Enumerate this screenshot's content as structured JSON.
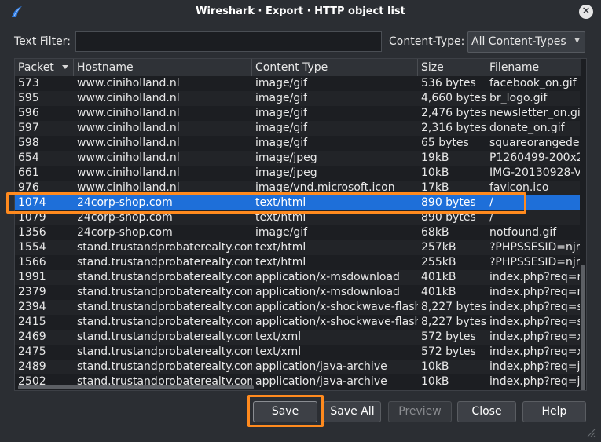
{
  "window": {
    "title": "Wireshark · Export · HTTP object list"
  },
  "filter": {
    "label": "Text Filter:",
    "value": ""
  },
  "content_type": {
    "label": "Content-Type:",
    "selected": "All Content-Types"
  },
  "table": {
    "headers": [
      "Packet",
      "Hostname",
      "Content Type",
      "Size",
      "Filename"
    ],
    "rows": [
      [
        "573",
        "www.ciniholland.nl",
        "image/gif",
        "536 bytes",
        "facebook_on.gif"
      ],
      [
        "595",
        "www.ciniholland.nl",
        "image/gif",
        "4,660 bytes",
        "br_logo.gif"
      ],
      [
        "596",
        "www.ciniholland.nl",
        "image/gif",
        "2,476 bytes",
        "newsletter_on.gif"
      ],
      [
        "597",
        "www.ciniholland.nl",
        "image/gif",
        "2,316 bytes",
        "donate_on.gif"
      ],
      [
        "598",
        "www.ciniholland.nl",
        "image/gif",
        "65 bytes",
        "squareorangedec"
      ],
      [
        "654",
        "www.ciniholland.nl",
        "image/jpeg",
        "19kB",
        "P1260499-200x2"
      ],
      [
        "661",
        "www.ciniholland.nl",
        "image/jpeg",
        "10kB",
        "IMG-20130928-V"
      ],
      [
        "976",
        "www.ciniholland.nl",
        "image/vnd.microsoft.icon",
        "17kB",
        "favicon.ico"
      ],
      [
        "1074",
        "24corp-shop.com",
        "text/html",
        "890 bytes",
        "/"
      ],
      [
        "1079",
        "24corp-shop.com",
        "text/html",
        "890 bytes",
        "/"
      ],
      [
        "1356",
        "24corp-shop.com",
        "image/gif",
        "68kB",
        "notfound.gif"
      ],
      [
        "1554",
        "stand.trustandprobaterealty.com",
        "text/html",
        "257kB",
        "?PHPSSESID=njr"
      ],
      [
        "1566",
        "stand.trustandprobaterealty.com",
        "text/html",
        "255kB",
        "?PHPSSESID=njr"
      ],
      [
        "1991",
        "stand.trustandprobaterealty.com",
        "application/x-msdownload",
        "401kB",
        "index.php?req=m"
      ],
      [
        "2379",
        "stand.trustandprobaterealty.com",
        "application/x-msdownload",
        "401kB",
        "index.php?req=m"
      ],
      [
        "2394",
        "stand.trustandprobaterealty.com",
        "application/x-shockwave-flash",
        "8,227 bytes",
        "index.php?req=sv"
      ],
      [
        "2415",
        "stand.trustandprobaterealty.com",
        "application/x-shockwave-flash",
        "8,227 bytes",
        "index.php?req=sv"
      ],
      [
        "2469",
        "stand.trustandprobaterealty.com",
        "text/xml",
        "572 bytes",
        "index.php?req=xr"
      ],
      [
        "2475",
        "stand.trustandprobaterealty.com",
        "text/xml",
        "572 bytes",
        "index.php?req=xr"
      ],
      [
        "2489",
        "stand.trustandprobaterealty.com",
        "application/java-archive",
        "10kB",
        "index.php?req=ja"
      ],
      [
        "2502",
        "stand.trustandprobaterealty.com",
        "application/java-archive",
        "10kB",
        "index.php?req=ja"
      ]
    ],
    "selected_index": 8
  },
  "buttons": {
    "save": "Save",
    "save_all": "Save All",
    "preview": "Preview",
    "close": "Close",
    "help": "Help"
  },
  "colors": {
    "highlight": "#ff8a1e",
    "selection": "#1e6fd9",
    "background": "#2b2e33"
  },
  "icons": {
    "app": "wireshark-fin-icon",
    "close": "close-icon",
    "sort": "sort-desc-icon",
    "grip": "resize-grip-icon"
  }
}
